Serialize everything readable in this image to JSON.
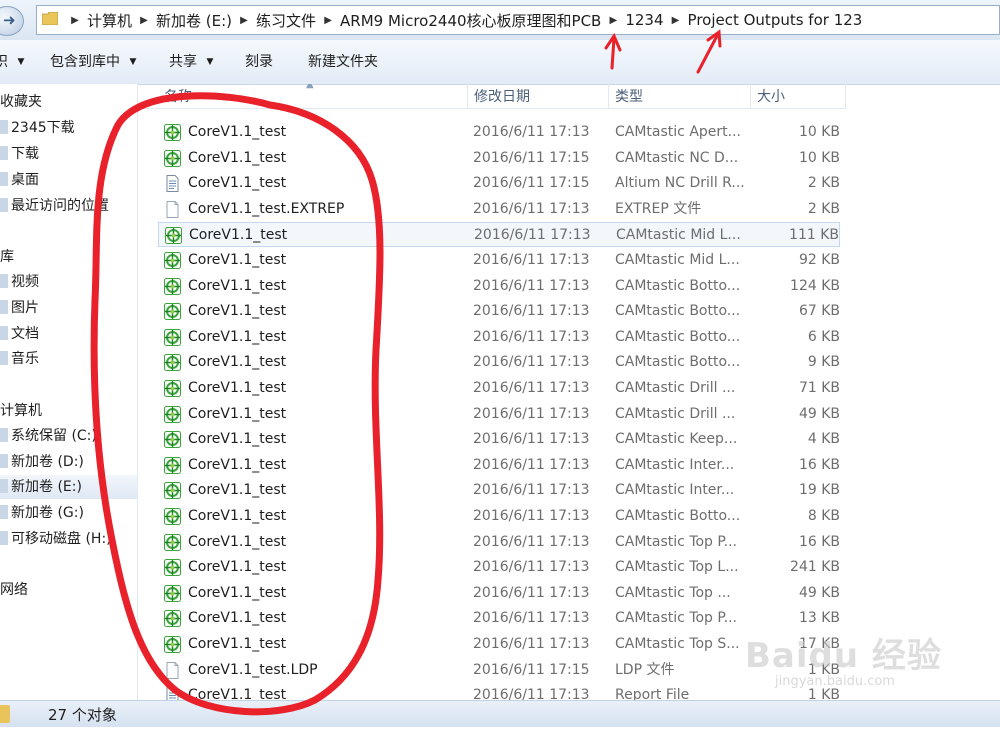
{
  "address": {
    "crumbs": [
      "计算机",
      "新加卷 (E:)",
      "练习文件",
      "ARM9 Micro2440核心板原理图和PCB",
      "1234",
      "Project Outputs for 123"
    ]
  },
  "toolbar": {
    "organize": "织",
    "include_library": "包含到库中",
    "share": "共享",
    "burn": "刻录",
    "new_folder": "新建文件夹"
  },
  "sidebar": {
    "items": [
      {
        "label": "收藏夹",
        "level": "group"
      },
      {
        "label": "2345下载",
        "level": "item"
      },
      {
        "label": "下载",
        "level": "item"
      },
      {
        "label": "桌面",
        "level": "item"
      },
      {
        "label": "最近访问的位置",
        "level": "item"
      },
      {
        "label": "库",
        "level": "group"
      },
      {
        "label": "视频",
        "level": "item"
      },
      {
        "label": "图片",
        "level": "item"
      },
      {
        "label": "文档",
        "level": "item"
      },
      {
        "label": "音乐",
        "level": "item"
      },
      {
        "label": "计算机",
        "level": "group"
      },
      {
        "label": "系统保留 (C:)",
        "level": "item"
      },
      {
        "label": "新加卷 (D:)",
        "level": "item"
      },
      {
        "label": "新加卷 (E:)",
        "level": "item",
        "selected": true
      },
      {
        "label": "新加卷 (G:)",
        "level": "item"
      },
      {
        "label": "可移动磁盘 (H:)",
        "level": "item"
      },
      {
        "label": "网络",
        "level": "group"
      }
    ]
  },
  "columns": {
    "name": "名称",
    "date": "修改日期",
    "type": "类型",
    "size": "大小"
  },
  "files": [
    {
      "name": "CoreV1.1_test",
      "date": "2016/6/11 17:13",
      "type": "CAMtastic Apert...",
      "size": "10 KB",
      "icon": "camtastic-icon"
    },
    {
      "name": "CoreV1.1_test",
      "date": "2016/6/11 17:15",
      "type": "CAMtastic NC D...",
      "size": "10 KB",
      "icon": "camtastic-icon"
    },
    {
      "name": "CoreV1.1_test",
      "date": "2016/6/11 17:15",
      "type": "Altium NC Drill R...",
      "size": "2 KB",
      "icon": "text-file-icon"
    },
    {
      "name": "CoreV1.1_test.EXTREP",
      "date": "2016/6/11 17:13",
      "type": "EXTREP 文件",
      "size": "2 KB",
      "icon": "blank-file-icon"
    },
    {
      "name": "CoreV1.1_test",
      "date": "2016/6/11 17:13",
      "type": "CAMtastic Mid L...",
      "size": "111 KB",
      "icon": "camtastic-icon",
      "hover": true
    },
    {
      "name": "CoreV1.1_test",
      "date": "2016/6/11 17:13",
      "type": "CAMtastic Mid L...",
      "size": "92 KB",
      "icon": "camtastic-icon"
    },
    {
      "name": "CoreV1.1_test",
      "date": "2016/6/11 17:13",
      "type": "CAMtastic Botto...",
      "size": "124 KB",
      "icon": "camtastic-icon"
    },
    {
      "name": "CoreV1.1_test",
      "date": "2016/6/11 17:13",
      "type": "CAMtastic Botto...",
      "size": "67 KB",
      "icon": "camtastic-icon"
    },
    {
      "name": "CoreV1.1_test",
      "date": "2016/6/11 17:13",
      "type": "CAMtastic Botto...",
      "size": "6 KB",
      "icon": "camtastic-icon"
    },
    {
      "name": "CoreV1.1_test",
      "date": "2016/6/11 17:13",
      "type": "CAMtastic Botto...",
      "size": "9 KB",
      "icon": "camtastic-icon"
    },
    {
      "name": "CoreV1.1_test",
      "date": "2016/6/11 17:13",
      "type": "CAMtastic Drill ...",
      "size": "71 KB",
      "icon": "camtastic-icon"
    },
    {
      "name": "CoreV1.1_test",
      "date": "2016/6/11 17:13",
      "type": "CAMtastic Drill ...",
      "size": "49 KB",
      "icon": "camtastic-icon"
    },
    {
      "name": "CoreV1.1_test",
      "date": "2016/6/11 17:13",
      "type": "CAMtastic Keep...",
      "size": "4 KB",
      "icon": "camtastic-icon"
    },
    {
      "name": "CoreV1.1_test",
      "date": "2016/6/11 17:13",
      "type": "CAMtastic Inter...",
      "size": "16 KB",
      "icon": "camtastic-icon"
    },
    {
      "name": "CoreV1.1_test",
      "date": "2016/6/11 17:13",
      "type": "CAMtastic Inter...",
      "size": "19 KB",
      "icon": "camtastic-icon"
    },
    {
      "name": "CoreV1.1_test",
      "date": "2016/6/11 17:13",
      "type": "CAMtastic Botto...",
      "size": "8 KB",
      "icon": "camtastic-icon"
    },
    {
      "name": "CoreV1.1_test",
      "date": "2016/6/11 17:13",
      "type": "CAMtastic Top P...",
      "size": "16 KB",
      "icon": "camtastic-icon"
    },
    {
      "name": "CoreV1.1_test",
      "date": "2016/6/11 17:13",
      "type": "CAMtastic Top L...",
      "size": "241 KB",
      "icon": "camtastic-icon"
    },
    {
      "name": "CoreV1.1_test",
      "date": "2016/6/11 17:13",
      "type": "CAMtastic Top ...",
      "size": "49 KB",
      "icon": "camtastic-icon"
    },
    {
      "name": "CoreV1.1_test",
      "date": "2016/6/11 17:13",
      "type": "CAMtastic Top P...",
      "size": "13 KB",
      "icon": "camtastic-icon"
    },
    {
      "name": "CoreV1.1_test",
      "date": "2016/6/11 17:13",
      "type": "CAMtastic Top S...",
      "size": "17 KB",
      "icon": "camtastic-icon"
    },
    {
      "name": "CoreV1.1_test.LDP",
      "date": "2016/6/11 17:15",
      "type": "LDP 文件",
      "size": "1 KB",
      "icon": "blank-file-icon"
    },
    {
      "name": "CoreV1.1_test",
      "date": "2016/6/11 17:13",
      "type": "Report File",
      "size": "1 KB",
      "icon": "text-file-icon"
    }
  ],
  "status": {
    "count_text": "27 个对象"
  },
  "watermark": {
    "text": "Baidu 经验",
    "sub": "jingyan.baidu.com"
  },
  "colors": {
    "annotation_red": "#e8212b",
    "camtastic_green": "#3aa63a",
    "selection_blue": "#c6d8ee"
  }
}
